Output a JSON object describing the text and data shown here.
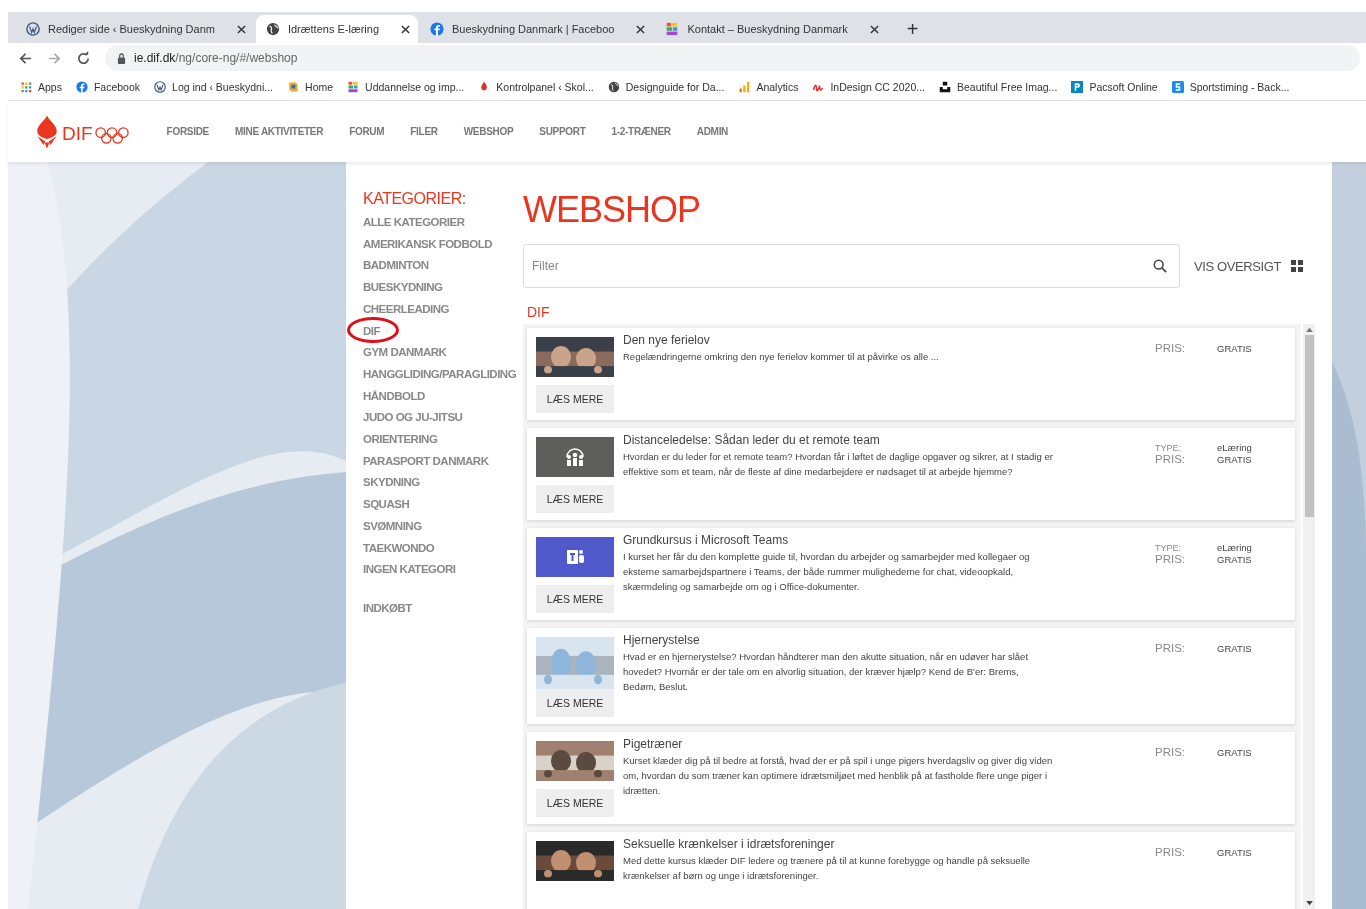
{
  "browser": {
    "tabs": [
      {
        "title": "Rediger side ‹ Bueskydning Danm",
        "kind": "wordpress",
        "selected": false
      },
      {
        "title": "Idrættens E-læring",
        "kind": "globe",
        "selected": true
      },
      {
        "title": "Bueskydning Danmark | Faceboo",
        "kind": "facebook",
        "selected": false
      },
      {
        "title": "Kontakt – Bueskydning Danmark",
        "kind": "colorful",
        "selected": false
      }
    ],
    "new_tab": "+",
    "address": {
      "host": "ie.dif.dk",
      "path": "/ng/core-ng/#/webshop"
    },
    "bookmarks": [
      {
        "label": "Apps",
        "kind": "apps"
      },
      {
        "label": "Facebook",
        "kind": "facebook"
      },
      {
        "label": "Log ind ‹ Bueskydni...",
        "kind": "wordpress"
      },
      {
        "label": "Home",
        "kind": "home"
      },
      {
        "label": "Uddannelse og imp...",
        "kind": "colorful"
      },
      {
        "label": "Kontrolpanel ‹ Skol...",
        "kind": "flame"
      },
      {
        "label": "Designguide for Da...",
        "kind": "globe"
      },
      {
        "label": "Analytics",
        "kind": "analytics"
      },
      {
        "label": "InDesign CC 2020...",
        "kind": "script"
      },
      {
        "label": "Beautiful Free Imag...",
        "kind": "unsplash"
      },
      {
        "label": "Pacsoft Online",
        "kind": "pacsoft"
      },
      {
        "label": "Sportstiming - Back...",
        "kind": "sportstiming"
      }
    ]
  },
  "site": {
    "logo": "DIF",
    "nav": [
      "FORSIDE",
      "MINE AKTIVITETER",
      "FORUM",
      "FILER",
      "WEBSHOP",
      "SUPPORT",
      "1-2-TRÆNER",
      "ADMIN"
    ]
  },
  "categories": {
    "heading": "KATEGORIER:",
    "items": [
      {
        "label": "ALLE KATEGORIER",
        "circled": false
      },
      {
        "label": "AMERIKANSK FODBOLD",
        "circled": false
      },
      {
        "label": "BADMINTON",
        "circled": false
      },
      {
        "label": "BUESKYDNING",
        "circled": false
      },
      {
        "label": "CHEERLEADING",
        "circled": false
      },
      {
        "label": "DIF",
        "circled": true
      },
      {
        "label": "GYM DANMARK",
        "circled": false
      },
      {
        "label": "HANGGLIDING/PARAGLIDING",
        "circled": false
      },
      {
        "label": "HÅNDBOLD",
        "circled": false
      },
      {
        "label": "JUDO OG JU-JITSU",
        "circled": false
      },
      {
        "label": "ORIENTERING",
        "circled": false
      },
      {
        "label": "PARASPORT DANMARK",
        "circled": false
      },
      {
        "label": "SKYDNING",
        "circled": false
      },
      {
        "label": "SQUASH",
        "circled": false
      },
      {
        "label": "SVØMNING",
        "circled": false
      },
      {
        "label": "TAEKWONDO",
        "circled": false
      },
      {
        "label": "INGEN KATEGORI",
        "circled": false
      }
    ],
    "purchased": "INDKØBT"
  },
  "webshop": {
    "title": "WEBSHOP",
    "filter": {
      "placeholder": "Filter"
    },
    "overview": "VIS OVERSIGT",
    "section": "DIF",
    "products": [
      {
        "title": "Den nye ferielov",
        "description": "Regelændringerne omkring den nye ferielov kommer til at påvirke os alle ...",
        "button": "LÆS MERE",
        "meta": [
          {
            "label": "PRIS:",
            "value": "GRATIS"
          }
        ]
      },
      {
        "kind": "people",
        "title": "Distanceledelse: Sådan leder du et remote team",
        "description": "Hvordan er du leder for et remote team? Hvordan får i løftet de daglige opgaver og sikrer, at I stadig er effektive som et team, når de fleste af dine medarbejdere er nødsaget til at arbejde hjemme?",
        "button": "LÆS MERE",
        "meta": [
          {
            "label": "TYPE:",
            "value": "eLæring"
          },
          {
            "label": "PRIS:",
            "value": "GRATIS"
          }
        ]
      },
      {
        "kind": "teams",
        "title": "Grundkursus i Microsoft Teams",
        "description": "I kurset her får du den komplette guide til, hvordan du arbejder og samarbejder med kollegaer og eksterne samarbejdspartnere i Teams, der både rummer mulighederne for chat, videoopkald, skærmdeling og samarbejde om og i Office-dokumenter.",
        "button": "LÆS MERE",
        "meta": [
          {
            "label": "TYPE:",
            "value": "eLæring"
          },
          {
            "label": "PRIS:",
            "value": "GRATIS"
          }
        ]
      },
      {
        "kind": "brain",
        "title": "Hjernerystelse",
        "description": "Hvad er en hjernerystelse? Hvordan håndterer man den akutte situation, når en udøver har slået hovedet? Hvornår er der tale om en alvorlig situation, der kræver hjælp? Kend de B'er: Brems, Bedøm, Beslut.",
        "button": "LÆS MERE",
        "meta": [
          {
            "label": "PRIS:",
            "value": "GRATIS"
          }
        ]
      },
      {
        "kind": "room",
        "title": "Pigetræner",
        "description": "Kurset klæder dig på til bedre at forstå, hvad der er på spil i unge pigers hverdagsliv og giver dig viden om, hvordan du som træner kan optimere idrætsmiljøet med henblik på at fastholde flere unge piger i idrætten.",
        "button": "LÆS MERE",
        "meta": [
          {
            "label": "PRIS:",
            "value": "GRATIS"
          }
        ]
      },
      {
        "kind": "phone",
        "title": "Seksuelle krænkelser i idrætsforeninger",
        "description": "Med dette kursus klæder DIF ledere og trænere på til at kunne forebygge og handle på seksuelle krænkelser af børn og unge i idrætsforeninger.",
        "meta": [
          {
            "label": "PRIS:",
            "value": "GRATIS"
          }
        ]
      }
    ]
  }
}
